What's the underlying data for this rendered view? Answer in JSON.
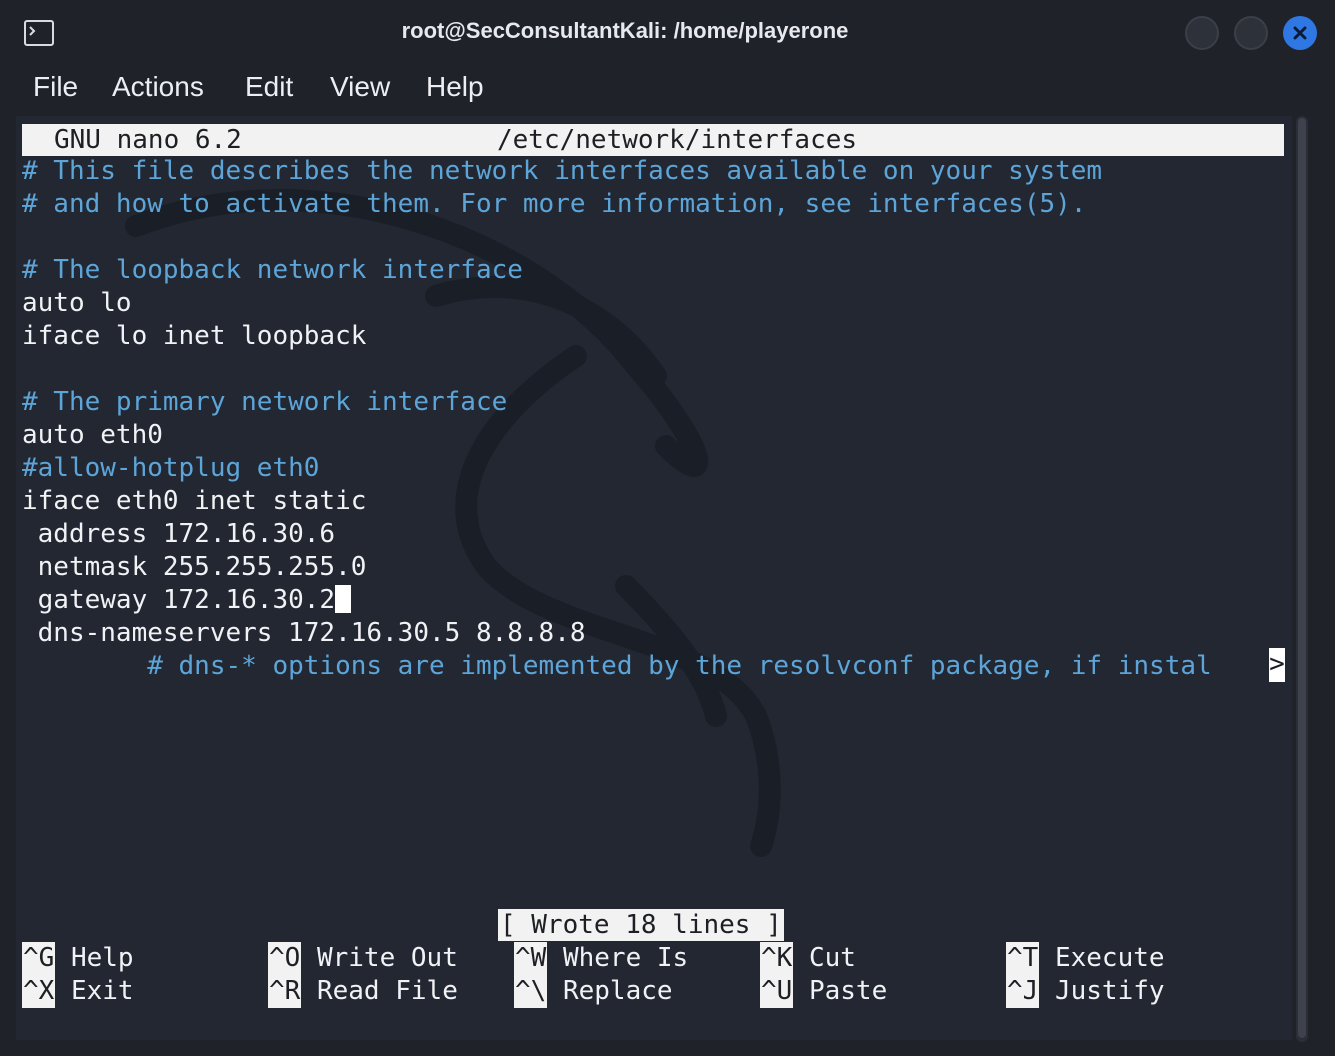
{
  "window": {
    "title": "root@SecConsultantKali: /home/playerone"
  },
  "menu": [
    "File",
    "Actions",
    "Edit",
    "View",
    "Help"
  ],
  "nano": {
    "version": "GNU nano 6.2",
    "filename": "/etc/network/interfaces",
    "lines": [
      {
        "text": "# This file describes the network interfaces available on your system",
        "type": "comment"
      },
      {
        "text": "# and how to activate them. For more information, see interfaces(5).",
        "type": "comment"
      },
      {
        "text": "",
        "type": "text"
      },
      {
        "text": "# The loopback network interface",
        "type": "comment"
      },
      {
        "text": "auto lo",
        "type": "text"
      },
      {
        "text": "iface lo inet loopback",
        "type": "text"
      },
      {
        "text": "",
        "type": "text"
      },
      {
        "text": "# The primary network interface",
        "type": "comment"
      },
      {
        "text": "auto eth0",
        "type": "text"
      },
      {
        "text": "#allow-hotplug eth0",
        "type": "comment"
      },
      {
        "text": "iface eth0 inet static",
        "type": "text"
      },
      {
        "text": " address 172.16.30.6",
        "type": "text"
      },
      {
        "text": " netmask 255.255.255.0",
        "type": "text"
      },
      {
        "text": " gateway 172.16.30.2",
        "type": "text"
      },
      {
        "text": " dns-nameservers 172.16.30.5 8.8.8.8",
        "type": "text"
      },
      {
        "text": "        # dns-* options are implemented by the resolvconf package, if instal",
        "type": "comment"
      }
    ],
    "overflow_marker": ">",
    "status_message": "[ Wrote 18 lines ]",
    "shortcuts": [
      {
        "key": "^G",
        "label": "Help"
      },
      {
        "key": "^X",
        "label": "Exit"
      },
      {
        "key": "^O",
        "label": "Write Out"
      },
      {
        "key": "^R",
        "label": "Read File"
      },
      {
        "key": "^W",
        "label": "Where Is"
      },
      {
        "key": "^\\",
        "label": "Replace"
      },
      {
        "key": "^K",
        "label": "Cut"
      },
      {
        "key": "^U",
        "label": "Paste"
      },
      {
        "key": "^T",
        "label": "Execute"
      },
      {
        "key": "^J",
        "label": "Justify"
      }
    ]
  },
  "colors": {
    "background": "#222731",
    "comment": "#5da5d8",
    "text": "#f1f2f5",
    "close_button": "#2f78e4"
  }
}
